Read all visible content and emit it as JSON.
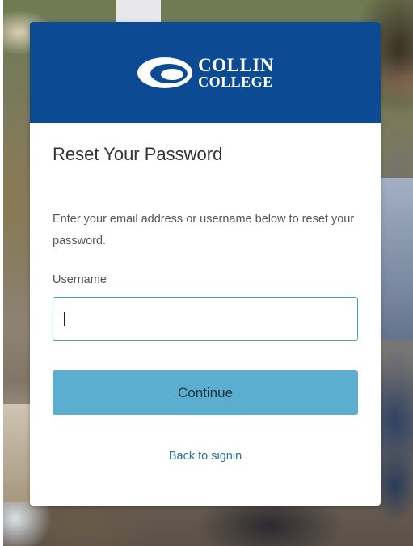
{
  "header": {
    "logo_line1": "COLLIN",
    "logo_line2": "COLLEGE",
    "brand_color": "#0c4a94"
  },
  "form": {
    "title": "Reset Your Password",
    "instructions": "Enter your email address or username below to reset your password.",
    "username_label": "Username",
    "username_value": "",
    "continue_label": "Continue",
    "back_link": "Back to signin"
  },
  "colors": {
    "button": "#5baed0",
    "input_border": "#45a3bf",
    "link": "#2a6f97"
  }
}
